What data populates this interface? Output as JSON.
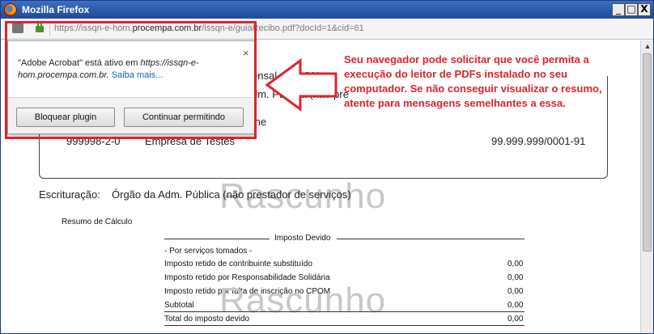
{
  "window": {
    "title": "Mozilla Firefox",
    "buttons": [
      "_",
      "□",
      "X"
    ]
  },
  "address_bar": {
    "url_prefix": "https://issqn-e-hom.",
    "url_domain": "procempa.com.br",
    "url_suffix": "/issqn-e/guiaRecibo.pdf?docId=1&cid=61"
  },
  "plugin_popup": {
    "message_a": "\"Adobe Acrobat\" está ativo em ",
    "message_site": "https://issqn-e-hom.procempa.com.br.",
    "learn_more": "Saiba mais...",
    "block_button": "Bloquear plugin",
    "allow_button": "Continuar permitindo",
    "close": "×"
  },
  "callout": {
    "text": "Seu navegador pode solicitar que você permita a execução do leitor de PDFs instalado no seu computador. Se não conseguir visualizar o resumo, atente para mensagens semelhantes a essa."
  },
  "pdf": {
    "header_partial_1": "ensal - ISSQN",
    "header_partial_2": "dm. Pública (não pre",
    "name_label_partial": "me",
    "inscricao": "999998-2-0",
    "empresa": "Empresa de Testes",
    "cnpj": "99.999.999/0001-91",
    "watermark": "Rascunho",
    "escrituracao_label": "Escrituração:",
    "escrituracao_value": "Órgão da Adm. Pública (não prestador de serviços)",
    "resumo_label": "Resumo de Cálculo",
    "imposto_header": "Imposto Devido",
    "section_label": "- Por serviços tomados -",
    "rows": [
      {
        "label": "Imposto retido de contribuinte substituído",
        "value": "0,00"
      },
      {
        "label": "Imposto retido por Responsabilidade Solidária",
        "value": "0,00"
      },
      {
        "label": "Imposto retido por falta de inscrição no CPOM",
        "value": "0,00"
      },
      {
        "label": "Subtotal",
        "value": "0,00"
      },
      {
        "label": "Total do imposto devido",
        "value": "0,00"
      }
    ]
  },
  "colors": {
    "accent_red": "#e0232b",
    "titlebar": "#2a57a8"
  }
}
